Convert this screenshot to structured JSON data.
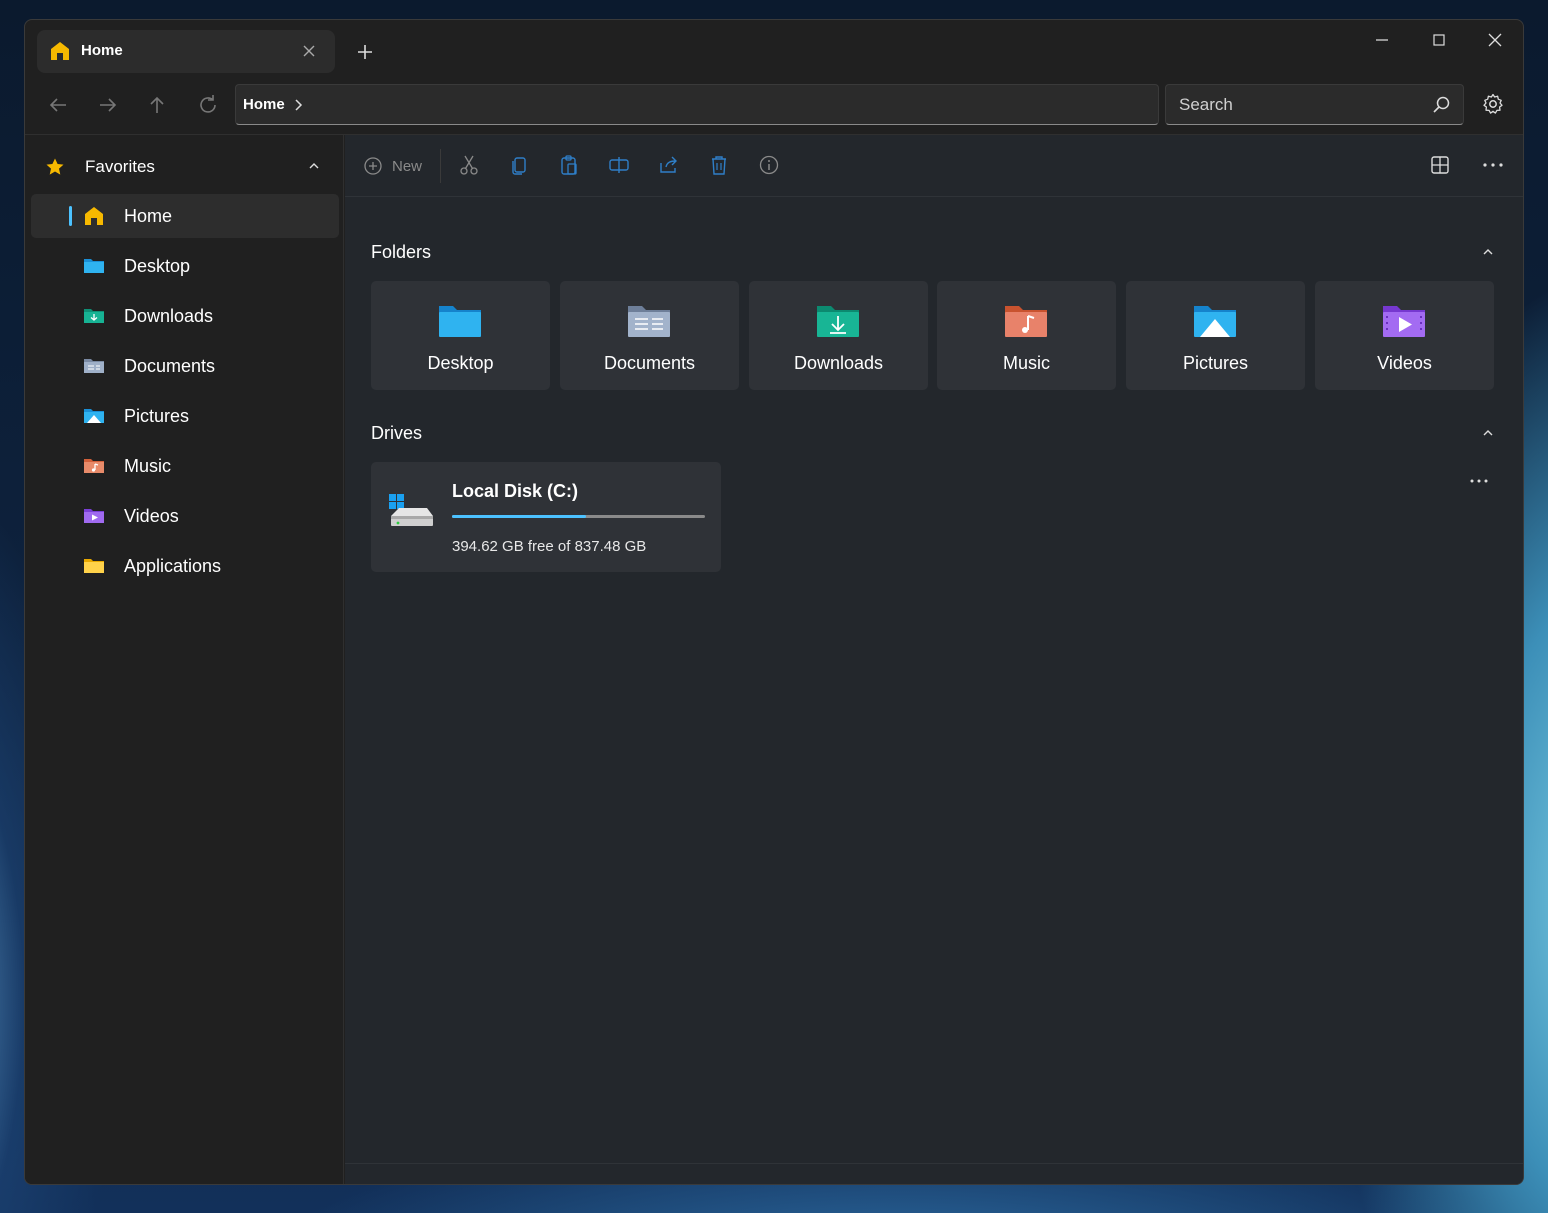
{
  "tab": {
    "title": "Home",
    "icon": "home-icon"
  },
  "window_controls": {
    "minimize": "minimize-icon",
    "maximize": "maximize-icon",
    "close": "close-icon"
  },
  "address_bar": {
    "breadcrumb": "Home"
  },
  "search": {
    "placeholder": "Search"
  },
  "sidebar": {
    "section_label": "Favorites",
    "items": [
      {
        "label": "Home",
        "icon": "home-icon",
        "active": true
      },
      {
        "label": "Desktop",
        "icon": "desktop-folder-icon"
      },
      {
        "label": "Downloads",
        "icon": "downloads-folder-icon"
      },
      {
        "label": "Documents",
        "icon": "documents-folder-icon"
      },
      {
        "label": "Pictures",
        "icon": "pictures-folder-icon"
      },
      {
        "label": "Music",
        "icon": "music-folder-icon"
      },
      {
        "label": "Videos",
        "icon": "videos-folder-icon"
      },
      {
        "label": "Applications",
        "icon": "applications-folder-icon"
      }
    ]
  },
  "toolbar": {
    "new_label": "New",
    "buttons": [
      "cut-icon",
      "copy-icon",
      "paste-icon",
      "rename-icon",
      "share-icon",
      "delete-icon",
      "properties-icon"
    ],
    "layout_icon": "layout-icon",
    "more_icon": "more-icon"
  },
  "folders_section": {
    "title": "Folders",
    "items": [
      {
        "label": "Desktop",
        "icon": "desktop-folder-icon"
      },
      {
        "label": "Documents",
        "icon": "documents-folder-icon"
      },
      {
        "label": "Downloads",
        "icon": "downloads-folder-icon"
      },
      {
        "label": "Music",
        "icon": "music-folder-icon"
      },
      {
        "label": "Pictures",
        "icon": "pictures-folder-icon"
      },
      {
        "label": "Videos",
        "icon": "videos-folder-icon"
      }
    ]
  },
  "drives_section": {
    "title": "Drives",
    "drives": [
      {
        "name": "Local Disk (C:)",
        "free_text": "394.62 GB free of 837.48 GB",
        "used_fraction": 0.529
      }
    ]
  },
  "colors": {
    "accent": "#4cc2ff",
    "window_bg": "#202020",
    "content_bg": "#23272c",
    "card_bg": "#2f3237"
  }
}
